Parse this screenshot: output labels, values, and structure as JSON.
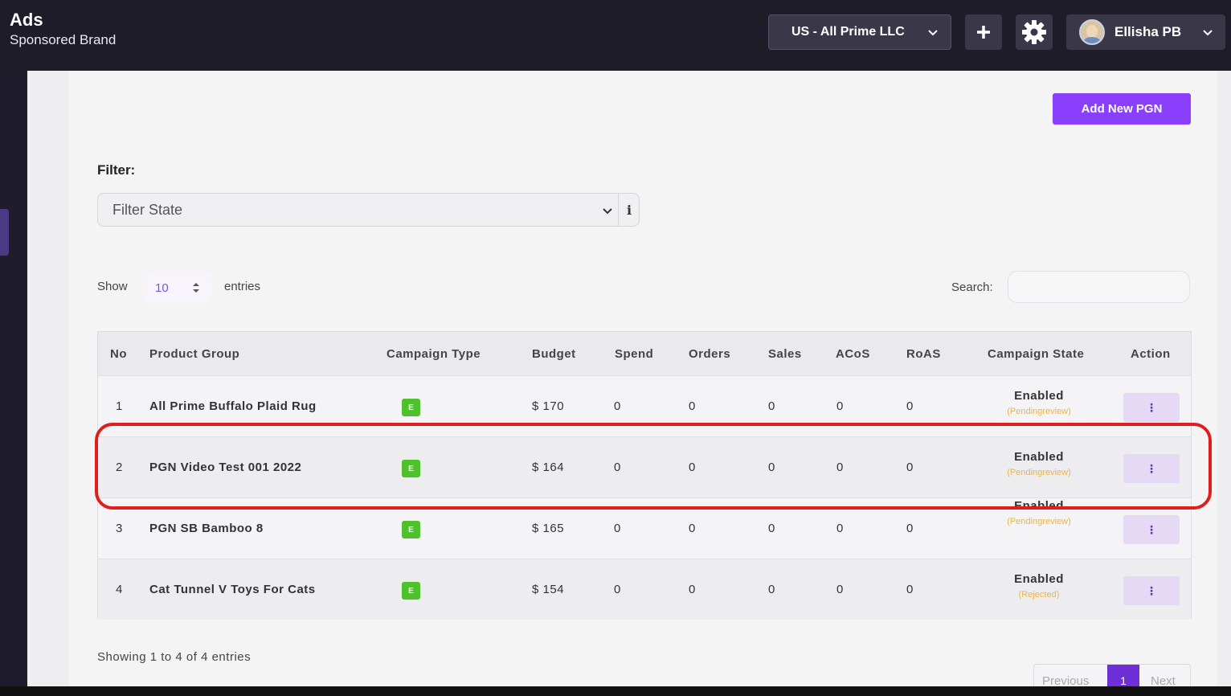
{
  "header": {
    "title": "Ads",
    "subtitle": "Sponsored Brand",
    "account": "US - All Prime LLC",
    "user_name": "Ellisha PB"
  },
  "toolbar": {
    "add_label": "Add New PGN"
  },
  "filter": {
    "label": "Filter:",
    "placeholder": "Filter State"
  },
  "length": {
    "show_label": "Show",
    "value": "10",
    "entries_label": "entries"
  },
  "search": {
    "label": "Search:"
  },
  "table": {
    "headers": [
      "No",
      "Product Group",
      "Campaign Type",
      "Budget",
      "Spend",
      "Orders",
      "Sales",
      "ACoS",
      "RoAS",
      "Campaign State",
      "Action"
    ],
    "rows": [
      {
        "no": "1",
        "product_group": "All Prime Buffalo Plaid Rug",
        "campaign_type": "E",
        "budget": "$ 170",
        "spend": "0",
        "orders": "0",
        "sales": "0",
        "acos": "0",
        "roas": "0",
        "state": "Enabled",
        "state_note": "(Pendingreview)",
        "action": "⋮"
      },
      {
        "no": "2",
        "product_group": "PGN Video Test 001 2022",
        "campaign_type": "E",
        "budget": "$ 164",
        "spend": "0",
        "orders": "0",
        "sales": "0",
        "acos": "0",
        "roas": "0",
        "state": "Enabled",
        "state_note": "(Pendingreview)",
        "action": "⋮"
      },
      {
        "no": "3",
        "product_group": "PGN SB Bamboo 8",
        "campaign_type": "E",
        "budget": "$ 165",
        "spend": "0",
        "orders": "0",
        "sales": "0",
        "acos": "0",
        "roas": "0",
        "state": "Enabled",
        "state_note": "(Pendingreview)",
        "action": "⋮"
      },
      {
        "no": "4",
        "product_group": "Cat Tunnel V Toys For Cats",
        "campaign_type": "E",
        "budget": "$ 154",
        "spend": "0",
        "orders": "0",
        "sales": "0",
        "acos": "0",
        "roas": "0",
        "state": "Enabled",
        "state_note": "(Rejected)",
        "action": "⋮"
      }
    ]
  },
  "footer": {
    "info": "Showing 1 to 4 of 4 entries",
    "previous": "Previous",
    "current_page": "1",
    "next": "Next"
  },
  "colors": {
    "accent": "#8a3ffc",
    "badge_green": "#4ec12d",
    "pending": "#e9b44c",
    "highlight": "#e01e1e"
  }
}
